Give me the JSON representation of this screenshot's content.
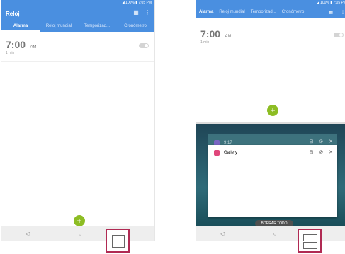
{
  "left": {
    "status": "◢ 100% ▮ 7:05 PM",
    "title": "Reloj",
    "tabs": [
      "Alarma",
      "Reloj mundial",
      "Temporizad...",
      "Cronómetro"
    ],
    "alarm_time": "7:00",
    "alarm_ampm": "AM",
    "alarm_sub": "1 min",
    "fab": "+",
    "nav_back": "◁",
    "nav_home": "○"
  },
  "right": {
    "status": "◢ 100% ▮ 7:05 PM",
    "tabs": [
      "Alarma",
      "Reloj mundial",
      "Temporizad...",
      "Cronómetro"
    ],
    "alarm_time": "7:00",
    "alarm_ampm": "AM",
    "alarm_sub": "1 min",
    "fab": "+",
    "recent_top_label": "9:17",
    "gallery_label": "Gallery",
    "clear_all": "BORRAR TODO",
    "nav_back": "◁",
    "nav_home": "○"
  },
  "colors": {
    "header": "#4a8fe0",
    "fab": "#8dbd24",
    "highlight": "#b02a53"
  },
  "icons": [
    "menu-icon",
    "more-icon",
    "back-icon",
    "home-icon",
    "overview-icon",
    "split-screen-icon",
    "gallery-icon",
    "close-icon",
    "pin-icon"
  ]
}
